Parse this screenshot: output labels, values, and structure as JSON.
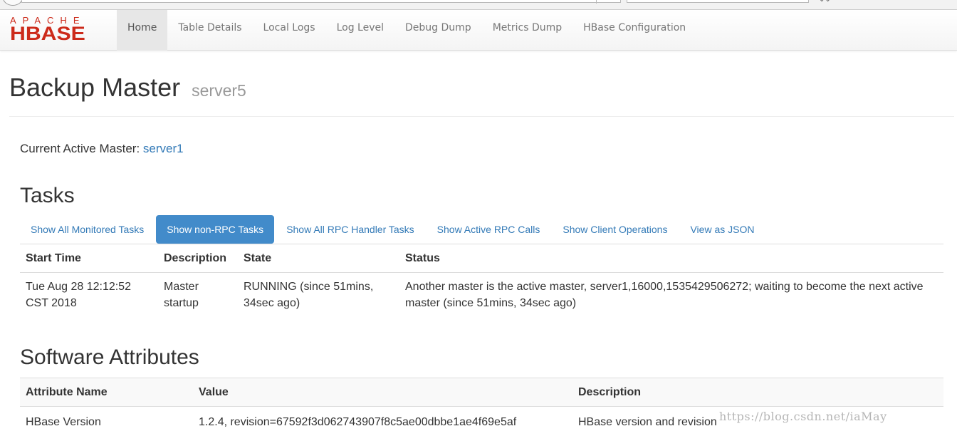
{
  "navbar": {
    "logo_top": "APACHE",
    "logo_main": "HBASE",
    "items": [
      {
        "label": "Home",
        "active": true
      },
      {
        "label": "Table Details"
      },
      {
        "label": "Local Logs"
      },
      {
        "label": "Log Level"
      },
      {
        "label": "Debug Dump"
      },
      {
        "label": "Metrics Dump"
      },
      {
        "label": "HBase Configuration"
      }
    ]
  },
  "header": {
    "title": "Backup Master",
    "server": "server5"
  },
  "active_master": {
    "label": "Current Active Master:",
    "value": "server1"
  },
  "tasks": {
    "title": "Tasks",
    "tabs": [
      {
        "label": "Show All Monitored Tasks"
      },
      {
        "label": "Show non-RPC Tasks",
        "active": true
      },
      {
        "label": "Show All RPC Handler Tasks"
      },
      {
        "label": "Show Active RPC Calls"
      },
      {
        "label": "Show Client Operations"
      },
      {
        "label": "View as JSON"
      }
    ],
    "columns": [
      "Start Time",
      "Description",
      "State",
      "Status"
    ],
    "rows": [
      {
        "start_time": "Tue Aug 28 12:12:52 CST 2018",
        "description": "Master startup",
        "state": "RUNNING (since 51mins, 34sec ago)",
        "status": "Another master is the active master, server1,16000,1535429506272; waiting to become the next active master (since 51mins, 34sec ago)"
      }
    ]
  },
  "software": {
    "title": "Software Attributes",
    "columns": [
      "Attribute Name",
      "Value",
      "Description"
    ],
    "rows": [
      {
        "name": "HBase Version",
        "value": "1.2.4, revision=67592f3d062743907f8c5ae00dbbe1ae4f69e5af",
        "description": "HBase version and revision"
      }
    ]
  },
  "watermark": "https://blog.csdn.net/iaMay",
  "colors": {
    "link": "#337ab7",
    "active_pill": "#428bca",
    "logo": "#cc2a1a"
  }
}
